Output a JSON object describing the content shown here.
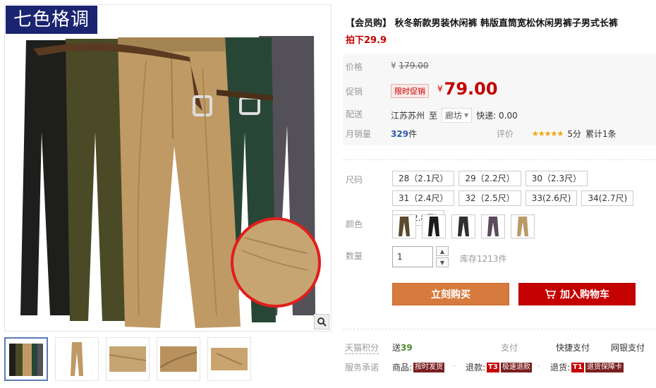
{
  "gallery": {
    "logo_text": "七色格调",
    "zoom_icon": "magnifier-icon",
    "thumbs": [
      "thumb-assorted-colors",
      "thumb-khaki-full",
      "thumb-fabric-detail-1",
      "thumb-fabric-detail-2",
      "thumb-fabric-detail-3"
    ],
    "pants_colors": [
      "#1e1f1c",
      "#4a4a26",
      "#bf9a65",
      "#284636",
      "#545058"
    ]
  },
  "product": {
    "title": "【会员购】 秋冬新款男装休闲裤 韩版直筒宽松休闲男裤子男式长裤",
    "subtitle": "拍下29.9"
  },
  "price": {
    "orig_label": "价格",
    "currency": "¥",
    "orig_value": "179.00",
    "promo_label": "促销",
    "promo_tag": "限时促销",
    "promo_value": "79.00",
    "ship_label": "配送",
    "ship_from": "江苏苏州",
    "ship_to_word": "至",
    "ship_dest": "廊坊",
    "ship_fee": "快递: 0.00",
    "sales_label": "月销量",
    "sales_value": "329",
    "sales_unit": "件",
    "rating_label": "评价",
    "rating_stars": "★★★★★",
    "rating_score": "5分",
    "rating_count": "累计1条"
  },
  "options": {
    "size_label": "尺码",
    "sizes": [
      "28（2.1尺）",
      "29（2.2尺）",
      "30（2.3尺）",
      "31（2.4尺）",
      "32（2.5尺）",
      "33(2.6尺)",
      "34(2.7尺)",
      "35(2.8尺)"
    ],
    "color_label": "颜色",
    "color_swatches": [
      "#5b4a2c",
      "#1b1b1b",
      "#2e2e33",
      "#5a4a5c",
      "#b89b66"
    ],
    "qty_label": "数量",
    "qty_value": "1",
    "stock": "库存1213件"
  },
  "actions": {
    "buy_now": "立刻购买",
    "add_cart": "加入购物车"
  },
  "footer": {
    "tmall_label": "天猫积分",
    "points_prefix": "送",
    "points_value": "39",
    "pay_label": "支付",
    "pay_1": "快捷支付",
    "pay_2": "网银支付",
    "service_label": "服务承诺",
    "svc_goods_label": "商品:",
    "svc_goods_tag": "按时发货",
    "svc_refund_label": "退款:",
    "svc_refund_tag1": "T3",
    "svc_refund_tag2": "极速退款",
    "svc_return_label": "退货:",
    "svc_return_tag1": "T1",
    "svc_return_tag2": "退货保障卡"
  },
  "colors": {
    "brand_red": "#c40000",
    "buy_orange": "#d77a3d"
  }
}
